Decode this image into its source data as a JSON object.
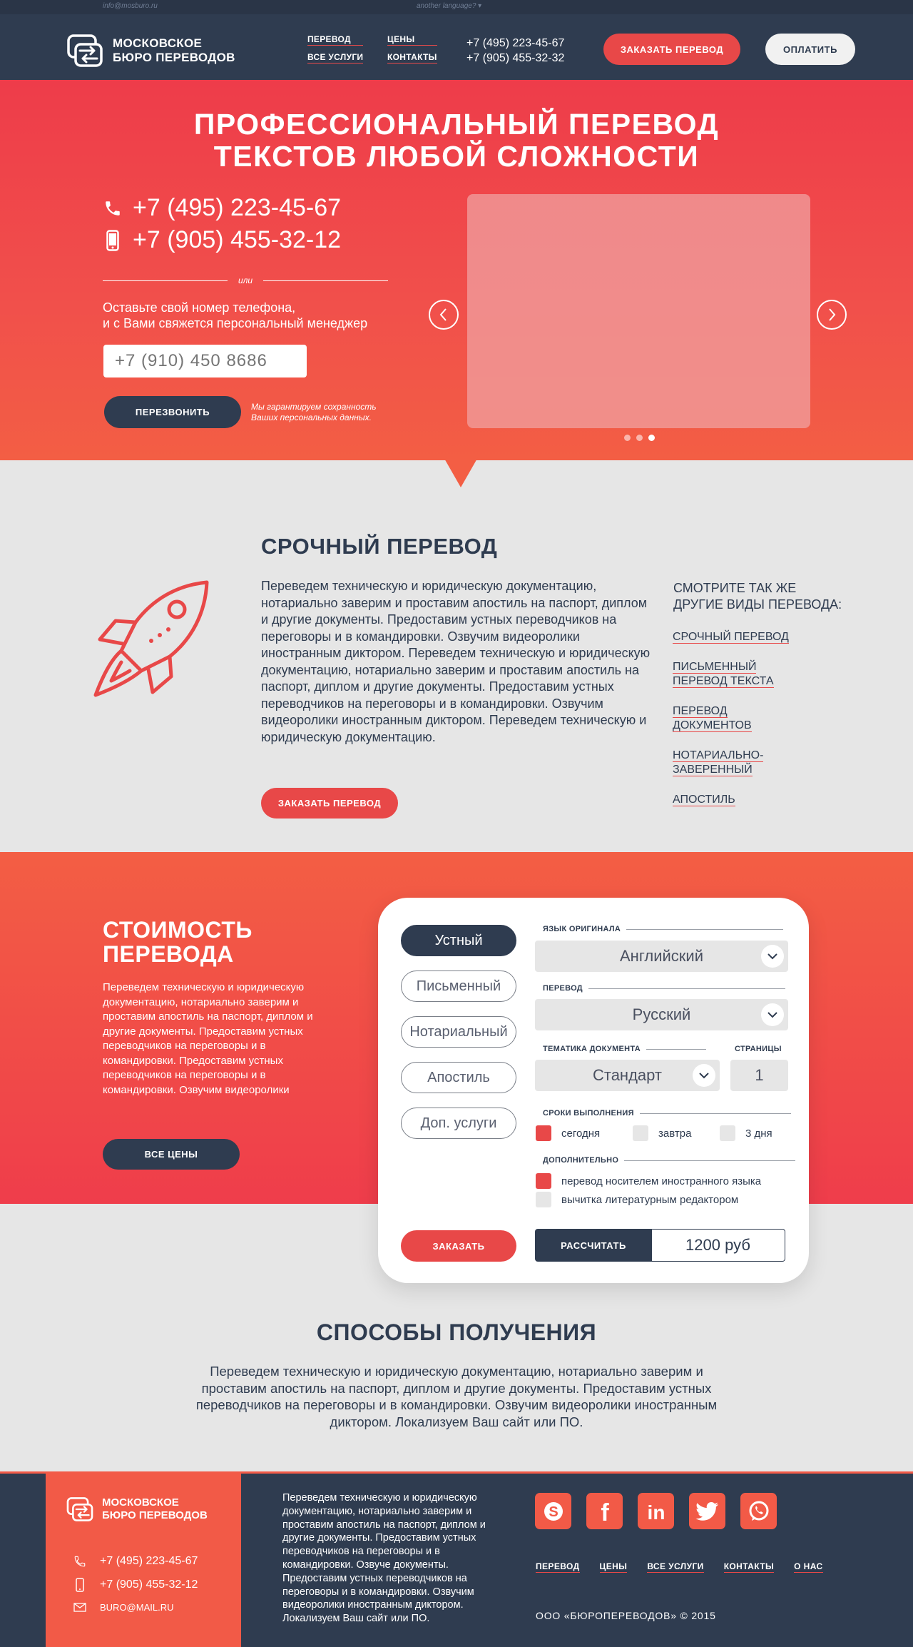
{
  "topbar": {
    "email": "info@mosburo.ru",
    "language": "another language? ▾"
  },
  "header": {
    "logo_line1": "МОСКОВСКОЕ",
    "logo_line2": "БЮРО ПЕРЕВОДОВ",
    "nav": [
      "ПЕРЕВОД",
      "ВСЕ УСЛУГИ",
      "ЦЕНЫ",
      "КОНТАКТЫ"
    ],
    "phone1": "+7 (495) 223-45-67",
    "phone2": "+7 (905) 455-32-32",
    "order_button": "ЗАКАЗАТЬ ПЕРЕВОД",
    "pay_button": "ОПЛАТИТЬ"
  },
  "hero": {
    "title_line1": "ПРОФЕССИОНАЛЬНЫЙ ПЕРЕВОД",
    "title_line2": "ТЕКСТОВ ЛЮБОЙ СЛОЖНОСТИ",
    "phone1": "+7 (495) 223-45-67",
    "phone2": "+7 (905) 455-32-12",
    "or": "или",
    "note_line1": "Оставьте свой номер телефона,",
    "note_line2": "и с Вами свяжется персональный менеджер",
    "phone_placeholder": "+7 (910) 450 8686",
    "callback_button": "ПЕРЕЗВОНИТЬ",
    "privacy_line1": "Мы гарантируем сохранность",
    "privacy_line2": "Ваших персональных данных.",
    "slider_active_index": 3,
    "slider_count": 3
  },
  "urgent": {
    "title": "СРОЧНЫЙ ПЕРЕВОД",
    "text": "Переведем техническую и юридическую документацию, нотариально заверим и проставим апостиль на паспорт, диплом и другие документы. Предоставим устных переводчиков на переговоры и в командировки. Озвучим видеоролики иностранным диктором. Переведем техническую  и юридическую документацию, нотариально заверим и проставим апостиль на паспорт, диплом и другие документы. Предоставим устных переводчиков на переговоры и в командировки. Озвучим видеоролики иностранным диктором. Переведем техническую и юридическую документацию.",
    "order_button": "ЗАКАЗАТЬ ПЕРЕВОД",
    "see_also_title_line1": "СМОТРИТЕ ТАК ЖЕ",
    "see_also_title_line2": "ДРУГИЕ ВИДЫ ПЕРЕВОДА:",
    "links": [
      [
        "СРОЧНЫЙ ПЕРЕВОД"
      ],
      [
        "ПИСЬМЕННЫЙ",
        "ПЕРЕВОД ТЕКСТА"
      ],
      [
        "ПЕРЕВОД",
        "ДОКУМЕНТОВ"
      ],
      [
        "НОТАРИАЛЬНО-",
        "ЗАВЕРЕННЫЙ"
      ],
      [
        "АПОСТИЛЬ"
      ]
    ]
  },
  "pricing": {
    "title_line1": "СТОИМОСТЬ",
    "title_line2": "ПЕРЕВОДА",
    "text": "Переведем техническую и юридическую документацию, нотариально заверим и проставим апостиль на паспорт, диплом и другие документы. Предоставим устных переводчиков на переговоры и в командировки. Предоставим устных переводчиков на переговоры и в командировки. Озвучим видеоролики",
    "all_prices_button": "ВСЕ ЦЕНЫ",
    "calculator": {
      "types": [
        "Устный",
        "Письменный",
        "Нотариальный",
        "Апостиль",
        "Доп. услуги"
      ],
      "active_type": 0,
      "source_lang_label": "ЯЗЫК ОРИГИНАЛА",
      "source_lang": "Английский",
      "target_lang_label": "ПЕРЕВОД",
      "target_lang": "Русский",
      "topic_label": "ТЕМАТИКА ДОКУМЕНТА",
      "topic": "Стандарт",
      "pages_label": "СТРАНИЦЫ",
      "pages": "1",
      "deadline_label": "СРОКИ ВЫПОЛНЕНИЯ",
      "deadlines": [
        "сегодня",
        "завтра",
        "3 дня"
      ],
      "deadline_selected": 0,
      "extra_label": "ДОПОЛНИТЕЛЬНО",
      "extras": [
        "перевод носителем иностранного языка",
        "вычитка литературным редактором"
      ],
      "extras_checked": [
        true,
        false
      ],
      "order_button": "ЗАКАЗАТЬ",
      "calc_button": "РАССЧИТАТЬ",
      "result": "1200 руб"
    }
  },
  "delivery": {
    "title": "СПОСОБЫ ПОЛУЧЕНИЯ",
    "text": "Переведем техническую и юридическую документацию, нотариально заверим и проставим апостиль на паспорт, диплом и другие документы. Предоставим устных переводчиков на переговоры и в командировки. Озвучим видеоролики иностранным диктором. Локализуем Ваш сайт или ПО."
  },
  "footer": {
    "logo_line1": "МОСКОВСКОЕ",
    "logo_line2": "БЮРО ПЕРЕВОДОВ",
    "phone1": "+7 (495) 223-45-67",
    "phone2": "+7 (905) 455-32-12",
    "email": "BURO@MAIL.RU",
    "text": "Переведем техническую и юридическую документацию, нотариально заверим и проставим апостиль на паспорт, диплом и другие документы. Предоставим устных переводчиков на переговоры и в командировки. Озвуче документы. Предоставим устных переводчиков на переговоры и в командировки. Озвучим видеоролики иностранным диктором. Локализуем Ваш сайт или ПО.",
    "socials": [
      "skype-icon",
      "facebook-icon",
      "linkedin-icon",
      "twitter-icon",
      "whatsapp-icon"
    ],
    "nav": [
      "ПЕРЕВОД",
      "ЦЕНЫ",
      "ВСЕ УСЛУГИ",
      "КОНТАКТЫ",
      "О НАС"
    ],
    "copyright": "ООО «БЮРОПЕРЕВОДОВ»  ©  2015"
  },
  "colors": {
    "accent": "#e84848",
    "dark": "#2f3c50",
    "background": "#e6e6e6"
  }
}
